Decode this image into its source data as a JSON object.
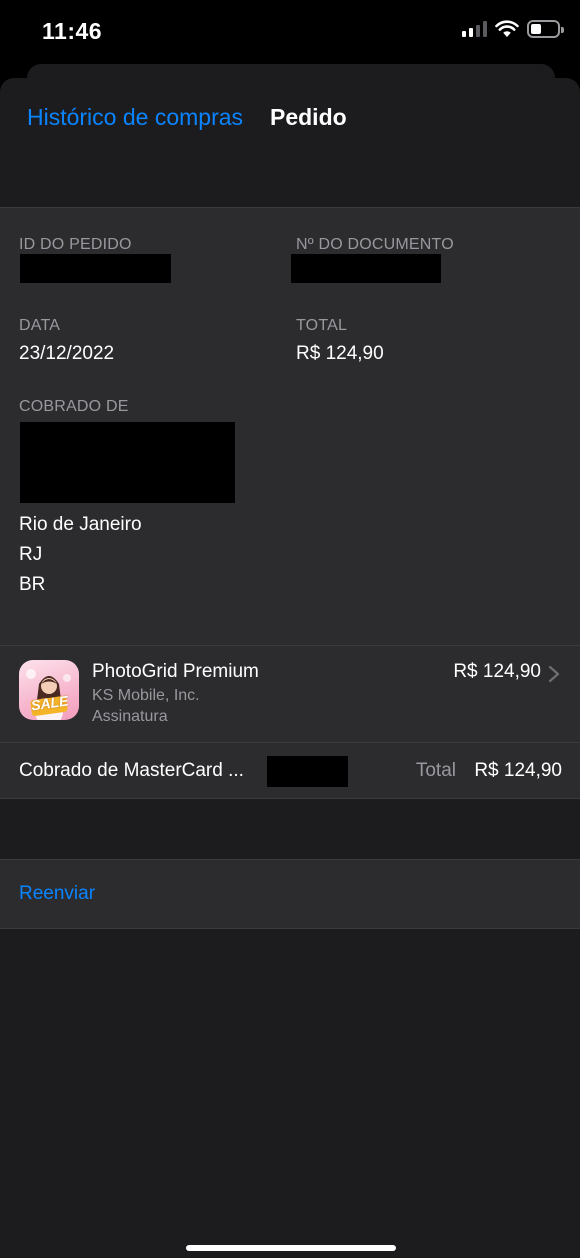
{
  "status_bar": {
    "time": "11:46",
    "icons": [
      "cellular-signal-icon",
      "wifi-icon",
      "battery-icon"
    ],
    "battery_level": 0.4
  },
  "nav": {
    "back_label": "Histórico de compras",
    "title": "Pedido"
  },
  "order": {
    "order_id_label": "ID DO PEDIDO",
    "document_label": "Nº DO DOCUMENTO",
    "date_label": "DATA",
    "date_value": "23/12/2022",
    "total_label": "TOTAL",
    "total_value": "R$ 124,90",
    "billed_label": "COBRADO DE",
    "address_lines": [
      "Rio de Janeiro",
      "RJ",
      "BR"
    ]
  },
  "item": {
    "name": "PhotoGrid Premium",
    "developer": "KS Mobile, Inc.",
    "type": "Assinatura",
    "price": "R$ 124,90",
    "icon_text": "SALE"
  },
  "charge": {
    "label": "Cobrado de MasterCard ...",
    "total_label": "Total",
    "total_value": "R$ 124,90"
  },
  "actions": {
    "resend_label": "Reenviar"
  },
  "colors": {
    "accent": "#0a84ff",
    "background": "#1c1c1e",
    "cell": "#2c2c2e",
    "secondary_text": "#98989f"
  }
}
